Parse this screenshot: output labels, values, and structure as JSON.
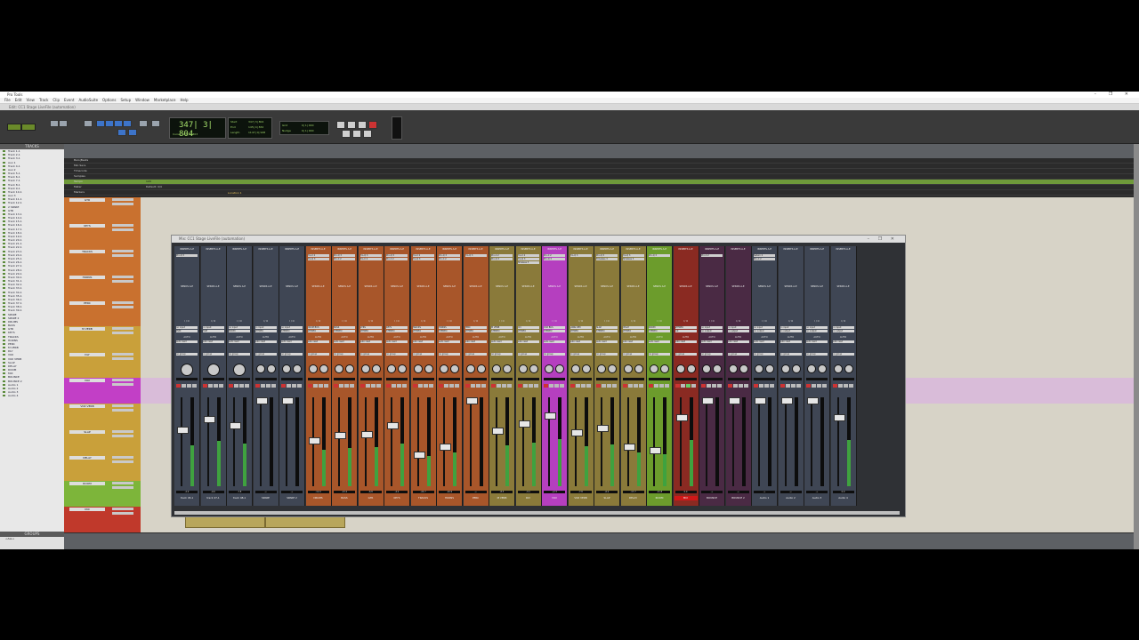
{
  "window": {
    "title": "Pro Tools",
    "session_title": "Edit: CC1 Stage LiveFile (automation)",
    "controls": "–  ❐  ✕"
  },
  "menu": [
    "File",
    "Edit",
    "View",
    "Track",
    "Clip",
    "Event",
    "AudioSuite",
    "Options",
    "Setup",
    "Window",
    "Marketplace",
    "Help"
  ],
  "toolbar": {
    "counter_main": "347| 3| 804",
    "counter_sub": "Cursor  347| 3| 803",
    "start_label": "Start",
    "end_label": "End",
    "length_label": "Length",
    "start_value": "347| 3| 804",
    "end_value": "145| 4| 832",
    "length_value": "1147| 0| 948",
    "grid_label": "Grid",
    "grid_value": "0| 1| 000",
    "nudge_label": "Nudge",
    "nudge_value": "0| 1| 000"
  },
  "left_panel": {
    "tracks_header": "TRACKS",
    "groups_header": "GROUPS",
    "group_all": "<ALL>",
    "tracks": [
      "Track 1-1",
      "Track 2-1",
      "Track 3-1",
      "Aux 1",
      "Track 4-1",
      "Aux 2",
      "Track 5-1",
      "Track 6-1",
      "Track 7-1",
      "Track 8-1",
      "Track 9-1",
      "Track 10-1",
      "Aux 3",
      "Track 11-1",
      "Track 12-1",
      "2 SPARE",
      "GTR",
      "Track 13-1",
      "Track 14-1",
      "Track 15-1",
      "Track 16-1",
      "Track 17-1",
      "Track 18-1",
      "Track 19-1",
      "Track 20-1",
      "Track 21-1",
      "Track 22-1",
      "Track 23-1",
      "Track 24-1",
      "Track 25-1",
      "Track 26-1",
      "Track 27-1",
      "Track 28-1",
      "Track 29-1",
      "Track 30-1",
      "Track 31-1",
      "Track 32-1",
      "Track 33-1",
      "Track 34-1",
      "Track 35-1",
      "Track 36-1",
      "Track 37-1",
      "Track 38-1",
      "Track 39-1",
      "SPARE",
      "SPARE 2",
      "DRUMS",
      "BASS",
      "GTR",
      "KEYS",
      "TRACKS",
      "HORNS",
      "PERC",
      "M VERB",
      "DLY",
      "VOX",
      "VOX VERB",
      "SLAP",
      "DELAY",
      "ROOM",
      "MIX",
      "BOUNCE",
      "BOUNCE 2",
      "Audio 1",
      "Audio 2",
      "Audio 3",
      "Audio 4"
    ]
  },
  "ruler": {
    "rows": [
      "Bars|Beats",
      "Min:Secs",
      "Timecode",
      "Samples",
      "Tempo",
      "Meter",
      "Markers"
    ],
    "tempo_value": "120",
    "meter_value": "Default: 4/4",
    "marker_value": "Location 1"
  },
  "edit_tracks": [
    {
      "name": "GTR",
      "color": "#c9712f"
    },
    {
      "name": "KEYS",
      "color": "#c9712f"
    },
    {
      "name": "TRACKS",
      "color": "#c9712f"
    },
    {
      "name": "HORNS",
      "color": "#c9712f"
    },
    {
      "name": "PERC",
      "color": "#c9712f"
    },
    {
      "name": "M VERB",
      "color": "#c9a03a"
    },
    {
      "name": "DLY",
      "color": "#c9a03a"
    },
    {
      "name": "VOX",
      "color": "#c23fc6"
    },
    {
      "name": "VOX VERB",
      "color": "#c9a03a"
    },
    {
      "name": "SLAP",
      "color": "#c9a03a"
    },
    {
      "name": "DELAY",
      "color": "#c9a03a"
    },
    {
      "name": "ROOM",
      "color": "#7db53a"
    },
    {
      "name": "MIX",
      "color": "#c0392b"
    }
  ],
  "clips": [
    "MIX_76",
    "MIX_77"
  ],
  "mix_window": {
    "title": "Mix: CC1 Stage LiveFile (automation)",
    "strips": [
      {
        "name": "track 45-1",
        "color": "#3f4654",
        "hdr": "INSERTS A-E",
        "slots": [
          "Pro-Q 3"
        ],
        "input": "no input",
        "output": "PGM",
        "vol": "-2.0",
        "fader": 0.35
      },
      {
        "name": "track 47-1",
        "color": "#3f4654",
        "hdr": "INSERTS A-E",
        "slots": [],
        "input": "no input",
        "output": "PGM",
        "vol": "-9.6",
        "fader": 0.22
      },
      {
        "name": "track 48-1",
        "color": "#3f4654",
        "hdr": "INSERTS A-E",
        "slots": [],
        "input": "no input",
        "output": "ROOM",
        "vol": "-7.8",
        "fader": 0.3
      },
      {
        "name": "SPARE",
        "color": "#3f4654",
        "hdr": "INSERTS A-E",
        "slots": [],
        "input": "no input",
        "output": "STEREO",
        "vol": "-∞",
        "fader": 0.0
      },
      {
        "name": "SPARE 2",
        "color": "#3f4654",
        "hdr": "INSERTS A-E",
        "slots": [],
        "input": "no input",
        "output": "STEREO",
        "vol": "-∞",
        "fader": 0.0
      },
      {
        "name": "DRUMS",
        "color": "#a8562a",
        "hdr": "INSERTS A-E",
        "slots": [
          "Pro-C 2",
          "Pro-Q 3"
        ],
        "input": "DRUM BUS",
        "output": "STEREO",
        "vol": "-11.0",
        "fader": 0.48
      },
      {
        "name": "BASS",
        "color": "#a8562a",
        "hdr": "INSERTS A-E",
        "slots": [
          "Pro-Q 3",
          "Pro-C 2"
        ],
        "input": "BASS",
        "output": "STEREO",
        "vol": "-13.2",
        "fader": 0.42
      },
      {
        "name": "GTR",
        "color": "#a8562a",
        "hdr": "INSERTS A-E",
        "slots": [
          "Pro-Q 3",
          "Pro-C 2"
        ],
        "input": "GTRS",
        "output": "STEREO",
        "vol": "-6.8",
        "fader": 0.4
      },
      {
        "name": "KEYS",
        "color": "#a8562a",
        "hdr": "INSERTS A-E",
        "slots": [
          "Pro-Q 3",
          "Pro-C 2"
        ],
        "input": "KEYS",
        "output": "STEREO",
        "vol": "-4.2",
        "fader": 0.3
      },
      {
        "name": "TRACKS",
        "color": "#a8562a",
        "hdr": "INSERTS A-E",
        "slots": [
          "Pro-C 2",
          "Pro-Q 3"
        ],
        "input": "TRACKS",
        "output": "STEREO",
        "vol": "-24.7",
        "fader": 0.65
      },
      {
        "name": "HORNS",
        "color": "#a8562a",
        "hdr": "INSERTS A-E",
        "slots": [
          "Pro-Q 3",
          "Pro-C 2"
        ],
        "input": "HORNS",
        "output": "STEREO",
        "vol": "-10.9",
        "fader": 0.55
      },
      {
        "name": "PERC",
        "color": "#a8562a",
        "hdr": "INSERTS A-E",
        "slots": [
          "Pro-Q 3"
        ],
        "input": "PERC",
        "output": "STEREO",
        "vol": "-∞",
        "fader": 0.0
      },
      {
        "name": "M VERB",
        "color": "#8a7a3a",
        "hdr": "INSERTS A-E",
        "slots": [
          "Pro-C 2",
          "Pro-Q 3"
        ],
        "input": "M VERB",
        "output": "STEREO",
        "vol": "-8.5",
        "fader": 0.36
      },
      {
        "name": "DLY",
        "color": "#8a7a3a",
        "hdr": "INSERTS A-E",
        "slots": [
          "Pro-C 2",
          "Pro-Q 3",
          "Timeless 3"
        ],
        "input": "DLY",
        "output": "STEREO",
        "vol": "-3.1",
        "fader": 0.28
      },
      {
        "name": "VOX",
        "color": "#b53fbf",
        "hdr": "INSERTS A-E",
        "slots": [
          "Pro-C 2",
          "Pro-Q 3"
        ],
        "input": "VOX BUS",
        "output": "STEREO",
        "vol": "+2.3",
        "fader": 0.18
      },
      {
        "name": "VOX VERB",
        "color": "#8a7a3a",
        "hdr": "INSERTS A-E",
        "slots": [
          "Pro-Q 3"
        ],
        "input": "LONG REV",
        "output": "STEREO",
        "vol": "-7.8",
        "fader": 0.38
      },
      {
        "name": "SLAP",
        "color": "#8a7a3a",
        "hdr": "INSERTS A-E",
        "slots": [
          "Pro-Q 3",
          "Timeless 3"
        ],
        "input": "SLAP",
        "output": "STEREO",
        "vol": "-6.2",
        "fader": 0.33
      },
      {
        "name": "DELAY",
        "color": "#8a7a3a",
        "hdr": "INSERTS A-E",
        "slots": [
          "Pro-Q 3",
          "Timeless 3"
        ],
        "input": "DELAY",
        "output": "STEREO",
        "vol": "-17.7",
        "fader": 0.55
      },
      {
        "name": "ROOM",
        "color": "#6c9c2c",
        "hdr": "INSERTS A-E",
        "slots": [
          "Pro-Q 3"
        ],
        "input": "ROOM",
        "output": "STEREO",
        "vol": "-11.8",
        "fader": 0.6
      },
      {
        "name": "MIX",
        "color": "#8a2a22",
        "hdr": "INSERTS A-E",
        "slots": [],
        "input": "STEREO",
        "output": "out",
        "vol": "0.0",
        "fader": 0.2
      },
      {
        "name": "BOUNCE",
        "color": "#4a2a44",
        "hdr": "INSERTS A-E",
        "slots": [
          "Pro-C 2"
        ],
        "input": "no input",
        "output": "no output",
        "vol": "-∞",
        "fader": 0.0
      },
      {
        "name": "BOUNCE 2",
        "color": "#4a2a44",
        "hdr": "INSERTS A-E",
        "slots": [],
        "input": "no input",
        "output": "no output",
        "vol": "-∞",
        "fader": 0.0
      },
      {
        "name": "Audio 1",
        "color": "#3f4654",
        "hdr": "INSERTS A-E",
        "slots": [
          "Saturn 2",
          "Pro-C 2"
        ],
        "input": "no input",
        "output": "no output",
        "vol": "-∞",
        "fader": 0.0
      },
      {
        "name": "Audio 2",
        "color": "#3f4654",
        "hdr": "INSERTS A-E",
        "slots": [],
        "input": "no input",
        "output": "no output",
        "vol": "-∞",
        "fader": 0.0
      },
      {
        "name": "Audio 3",
        "color": "#3f4654",
        "hdr": "INSERTS A-E",
        "slots": [],
        "input": "no input",
        "output": "no output",
        "vol": "-∞",
        "fader": 0.0
      },
      {
        "name": "Audio 4",
        "color": "#3f4654",
        "hdr": "INSERTS A-E",
        "slots": [],
        "input": "no input",
        "output": "no output",
        "vol": "0.0",
        "fader": 0.2
      }
    ],
    "sends_label": "SENDS A-E",
    "io_label": "I / O",
    "auto_label": "AUTO",
    "auto_value": "auto read",
    "group_value": "no group"
  }
}
